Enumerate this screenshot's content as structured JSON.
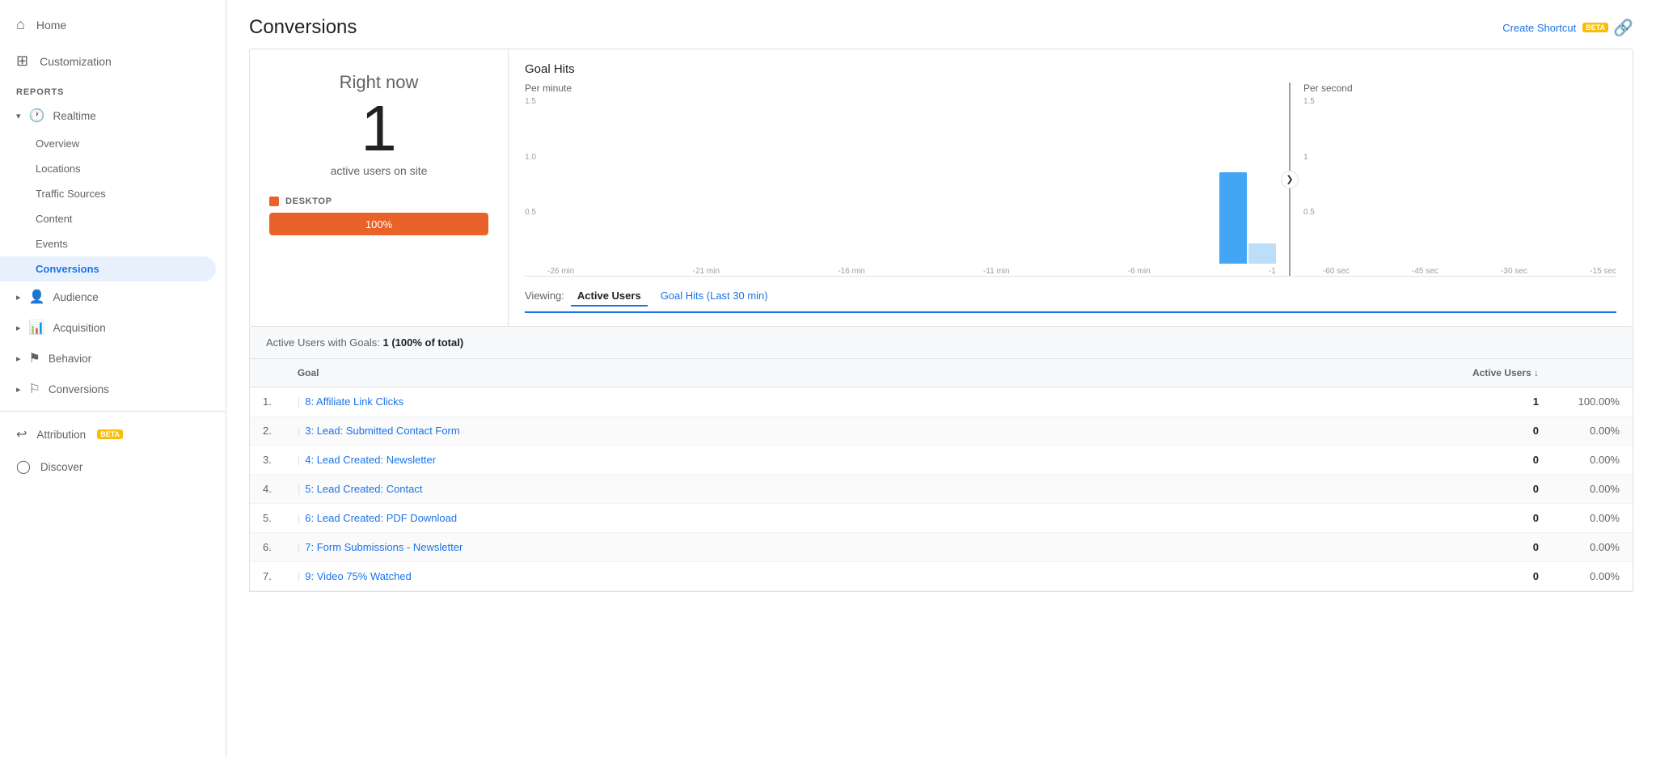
{
  "sidebar": {
    "home_label": "Home",
    "customization_label": "Customization",
    "reports_section": "REPORTS",
    "realtime_label": "Realtime",
    "realtime_sub": [
      {
        "id": "overview",
        "label": "Overview"
      },
      {
        "id": "locations",
        "label": "Locations"
      },
      {
        "id": "traffic_sources",
        "label": "Traffic Sources"
      },
      {
        "id": "content",
        "label": "Content"
      },
      {
        "id": "events",
        "label": "Events"
      },
      {
        "id": "conversions",
        "label": "Conversions",
        "active": true
      }
    ],
    "audience_label": "Audience",
    "acquisition_label": "Acquisition",
    "behavior_label": "Behavior",
    "conversions_label": "Conversions",
    "attribution_label": "Attribution",
    "attribution_beta": "BETA",
    "discover_label": "Discover"
  },
  "header": {
    "title": "Conversions",
    "create_shortcut": "Create Shortcut",
    "beta": "BETA"
  },
  "right_now": {
    "label": "Right now",
    "count": "1",
    "sub_label": "active users on site",
    "device_label": "DESKTOP",
    "progress_pct": "100%",
    "progress_bar_color": "#e8622a"
  },
  "chart": {
    "title": "Goal Hits",
    "per_minute_label": "Per minute",
    "per_second_label": "Per second",
    "y_labels_left": [
      "1.5",
      "1.0",
      "0.5",
      ""
    ],
    "x_labels_left": [
      "-26 min",
      "-21 min",
      "-16 min",
      "-11 min",
      "-6 min",
      "-1"
    ],
    "y_labels_right": [
      "1.5",
      "1",
      "0.5",
      ""
    ],
    "x_labels_right": [
      "-60 sec",
      "-45 sec",
      "-30 sec",
      "-15 sec"
    ],
    "bars_left": [
      0,
      0,
      0,
      0,
      0,
      0,
      0,
      0,
      0,
      0,
      0,
      0,
      0,
      0,
      0,
      0,
      0,
      0,
      0,
      0,
      0,
      0,
      0,
      0.7,
      0.15
    ],
    "bars_right": [
      0,
      0,
      0,
      0,
      0,
      0,
      0,
      0,
      0,
      0,
      0,
      0,
      0,
      0,
      0,
      0,
      0,
      0,
      0,
      0,
      0,
      0,
      0,
      0,
      0,
      0,
      0,
      0,
      0,
      0,
      0,
      0,
      0,
      0,
      0,
      0,
      0,
      0,
      0,
      0,
      0,
      0,
      0,
      0,
      0,
      0,
      0,
      0,
      0,
      0,
      0,
      0,
      0,
      0,
      0,
      0,
      0,
      0,
      0,
      0
    ]
  },
  "viewing": {
    "label": "Viewing:",
    "tab_active": "Active Users",
    "tab_inactive": "Goal Hits (Last 30 min)"
  },
  "table": {
    "summary_prefix": "Active Users with Goals:",
    "summary_value": "1 (100% of total)",
    "col_goal": "Goal",
    "col_active_users": "Active Users",
    "rows": [
      {
        "num": "1.",
        "goal": "8: Affiliate Link Clicks",
        "count": "1",
        "pct": "100.00%"
      },
      {
        "num": "2.",
        "goal": "3: Lead: Submitted Contact Form",
        "count": "0",
        "pct": "0.00%"
      },
      {
        "num": "3.",
        "goal": "4: Lead Created: Newsletter",
        "count": "0",
        "pct": "0.00%"
      },
      {
        "num": "4.",
        "goal": "5: Lead Created: Contact",
        "count": "0",
        "pct": "0.00%"
      },
      {
        "num": "5.",
        "goal": "6: Lead Created: PDF Download",
        "count": "0",
        "pct": "0.00%"
      },
      {
        "num": "6.",
        "goal": "7: Form Submissions - Newsletter",
        "count": "0",
        "pct": "0.00%"
      },
      {
        "num": "7.",
        "goal": "9: Video 75% Watched",
        "count": "0",
        "pct": "0.00%"
      }
    ]
  },
  "icons": {
    "home": "⌂",
    "customization": "⊞",
    "realtime": "🕐",
    "audience": "👤",
    "acquisition": "📊",
    "behavior": "⚑",
    "conversions_sidebar": "⚐",
    "attribution": "↩",
    "discover": "◯",
    "create_shortcut": "🔗",
    "chevron_down": "▾",
    "chevron_right": "❯",
    "sort_down": "↓"
  }
}
